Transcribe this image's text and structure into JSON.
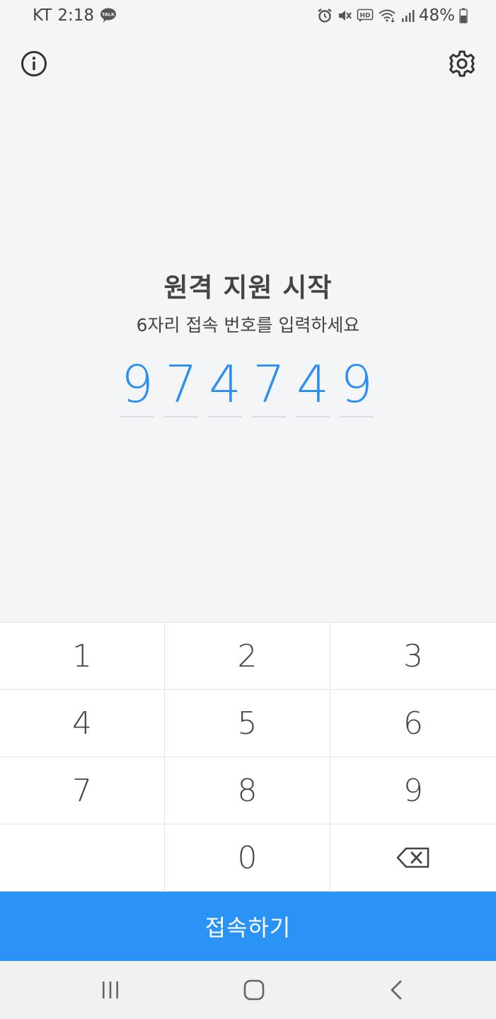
{
  "status_bar": {
    "carrier": "KT",
    "time": "2:18",
    "talk_badge": "TALK",
    "hd_badge": "HD",
    "battery": "48%"
  },
  "header": {
    "info_icon": "info-icon",
    "settings_icon": "gear-icon"
  },
  "main": {
    "title": "원격 지원 시작",
    "subtitle": "6자리 접속 번호를 입력하세요",
    "code_digits": [
      "9",
      "7",
      "4",
      "7",
      "4",
      "9"
    ]
  },
  "keypad": {
    "keys": [
      "1",
      "2",
      "3",
      "4",
      "5",
      "6",
      "7",
      "8",
      "9",
      "",
      "0"
    ],
    "backspace_icon": "backspace-icon"
  },
  "connect_button": {
    "label": "접속하기"
  },
  "colors": {
    "accent": "#2b93f5",
    "code_digit": "#2d8ff0",
    "background": "#f4f5f7"
  },
  "nav_bar": {
    "recents_icon": "recents-icon",
    "home_icon": "home-icon",
    "back_icon": "back-icon"
  }
}
